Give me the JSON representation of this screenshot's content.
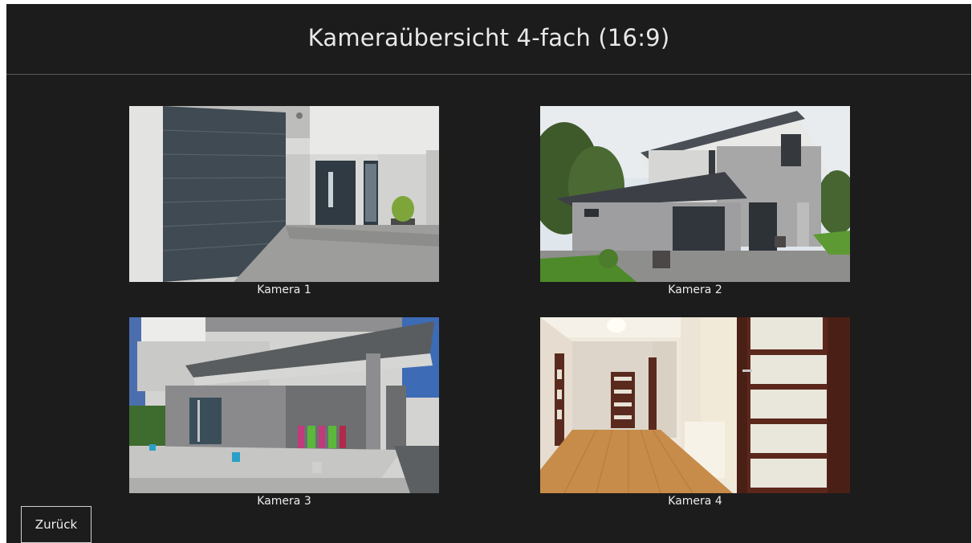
{
  "header": {
    "title": "Kameraübersicht 4-fach (16:9)"
  },
  "cameras": [
    {
      "label": "Kamera 1",
      "scene": "garage-entrance"
    },
    {
      "label": "Kamera 2",
      "scene": "house-exterior"
    },
    {
      "label": "Kamera 3",
      "scene": "patio"
    },
    {
      "label": "Kamera 4",
      "scene": "hallway-interior"
    }
  ],
  "footer": {
    "back_label": "Zurück"
  },
  "colors": {
    "background": "#1c1c1c",
    "text": "#e8e8e8",
    "divider": "#5a5a5a"
  }
}
